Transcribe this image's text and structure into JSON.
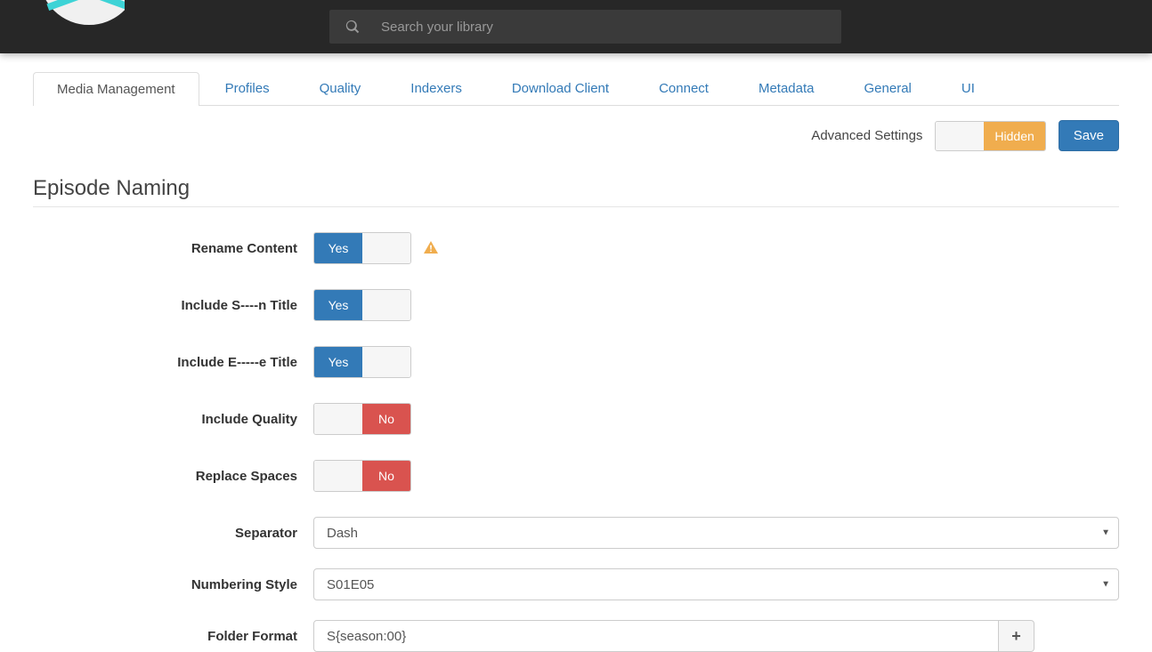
{
  "search": {
    "placeholder": "Search your library"
  },
  "tabs": [
    "Media Management",
    "Profiles",
    "Quality",
    "Indexers",
    "Download Client",
    "Connect",
    "Metadata",
    "General",
    "UI"
  ],
  "active_tab": 0,
  "settings_row": {
    "advanced_label": "Advanced Settings",
    "advanced_value": "Hidden",
    "save_label": "Save"
  },
  "section_title": "Episode Naming",
  "fields": {
    "rename_content": {
      "label": "Rename Content",
      "value": "Yes"
    },
    "include_sn_title": {
      "label": "Include S----n Title",
      "value": "Yes"
    },
    "include_ep_title": {
      "label": "Include E-----e Title",
      "value": "Yes"
    },
    "include_quality": {
      "label": "Include Quality",
      "value": "No"
    },
    "replace_spaces": {
      "label": "Replace Spaces",
      "value": "No"
    },
    "separator": {
      "label": "Separator",
      "value": "Dash"
    },
    "numbering_style": {
      "label": "Numbering Style",
      "value": "S01E05"
    },
    "folder_format": {
      "label": "Folder Format",
      "value": "S{season:00}"
    }
  }
}
